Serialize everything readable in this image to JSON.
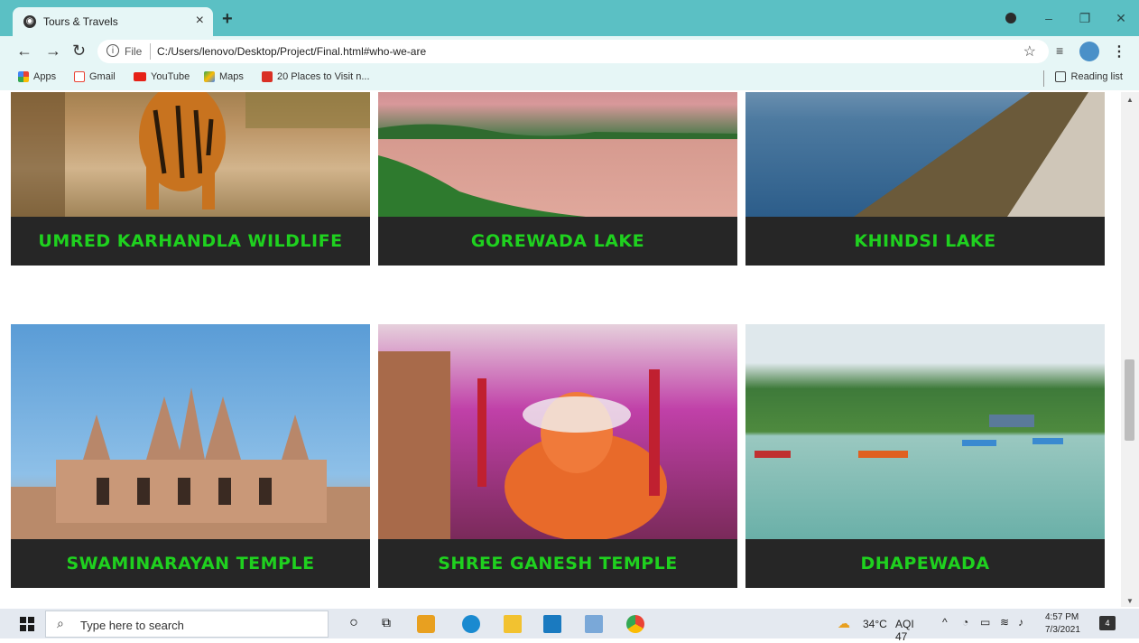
{
  "browser": {
    "tab_title": "Tours & Travels",
    "tab_close": "×",
    "new_tab": "+",
    "url_scheme": "File",
    "url": "C:/Users/lenovo/Desktop/Project/Final.html#who-we-are",
    "window_controls": {
      "minimize": "–",
      "restore": "❐",
      "close": "✕"
    }
  },
  "bookmarks": {
    "items": [
      "Apps",
      "Gmail",
      "YouTube",
      "Maps",
      "20 Places to Visit n..."
    ],
    "reading_list": "Reading list"
  },
  "cards": [
    {
      "caption": "UMRED KARHANDLA WILDLIFE",
      "icon": "tiger-photo"
    },
    {
      "caption": "GOREWADA LAKE",
      "icon": "sunset-lake-photo"
    },
    {
      "caption": "KHINDSI LAKE",
      "icon": "lake-dam-photo"
    },
    {
      "caption": "SWAMINARAYAN TEMPLE",
      "icon": "temple-photo"
    },
    {
      "caption": "SHREE GANESH TEMPLE",
      "icon": "ganesh-idol-photo"
    },
    {
      "caption": "DHAPEWADA",
      "icon": "boating-lake-photo"
    }
  ],
  "taskbar": {
    "search_placeholder": "Type here to search",
    "weather": "34°C",
    "aqi": "AQI 47",
    "time": "4:57 PM",
    "date": "7/3/2021",
    "notifications": "4"
  },
  "colors": {
    "chrome_accent": "#5bc0c4",
    "caption_bg": "#262626",
    "caption_text": "#1fd11f"
  }
}
